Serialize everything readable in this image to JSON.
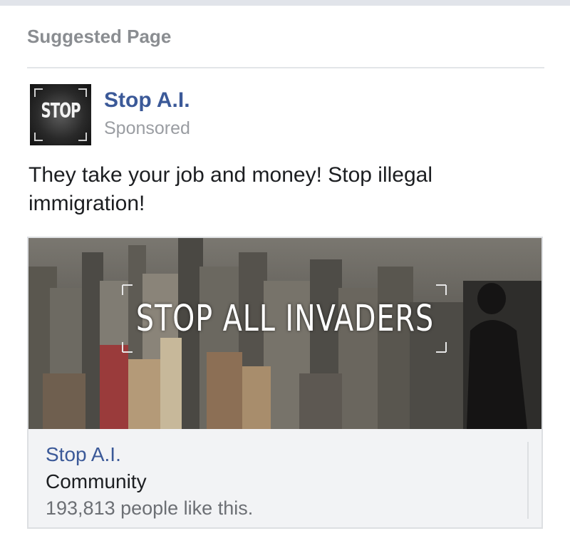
{
  "section": {
    "title": "Suggested Page"
  },
  "post": {
    "page_name": "Stop A.I.",
    "sponsored_label": "Sponsored",
    "avatar_text": "STOP",
    "body_text": "They take your job and money! Stop illegal immigration!"
  },
  "card": {
    "headline": "STOP ALL INVADERS",
    "page_name": "Stop A.I.",
    "category": "Community",
    "likes_text": "193,813 people like this."
  },
  "colors": {
    "link_blue": "#3b5998",
    "muted_gray": "#9a9da2",
    "card_bg": "#f2f3f5"
  }
}
